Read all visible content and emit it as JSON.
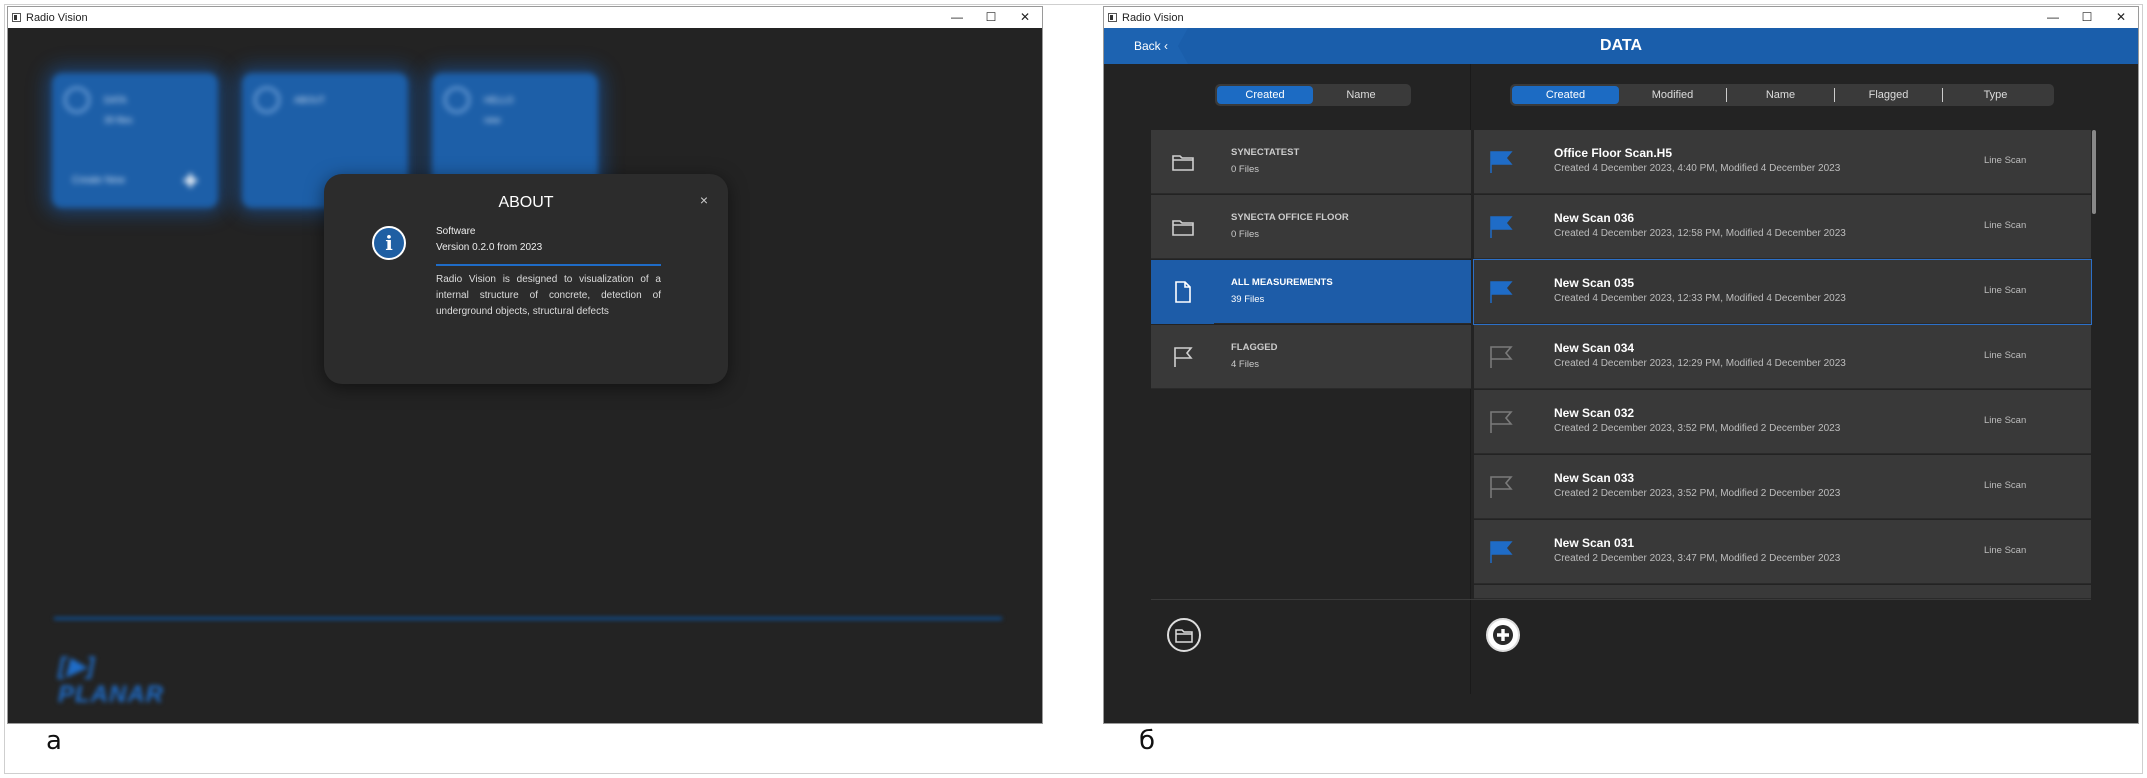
{
  "left_window": {
    "title": "Radio Vision",
    "controls": {
      "minimize": "—",
      "maximize": "☐",
      "close": "✕"
    },
    "tiles": [
      {
        "label": "DATA",
        "sub": "39 files",
        "footer": "Create New",
        "plus": "✚"
      },
      {
        "label": "ABOUT",
        "sub": ""
      },
      {
        "label": "HELLO",
        "sub": "new"
      }
    ],
    "logo": "[▶] PLANAR",
    "about": {
      "title": "ABOUT",
      "close": "×",
      "info_glyph": "i",
      "software_label": "Software",
      "version": "Version 0.2.0 from 2023",
      "description": "Radio Vision is designed to visualization of a internal structure of concrete, detection of underground objects, structural defects"
    }
  },
  "right_window": {
    "title": "Radio Vision",
    "controls": {
      "minimize": "—",
      "maximize": "☐",
      "close": "✕"
    },
    "back_label": "Back  ‹",
    "header_title": "DATA",
    "folder_sort": [
      "Created",
      "Name"
    ],
    "file_sort": [
      "Created",
      "Modified",
      "Name",
      "Flagged",
      "Type"
    ],
    "folders": [
      {
        "name": "SYNECTATEST",
        "count": "0 Files",
        "icon": "folder-icon",
        "selected": false
      },
      {
        "name": "SYNECTA OFFICE FLOOR",
        "count": "0 Files",
        "icon": "folder-icon",
        "selected": false
      },
      {
        "name": "ALL MEASUREMENTS",
        "count": "39 Files",
        "icon": "file-icon",
        "selected": true
      },
      {
        "name": "FLAGGED",
        "count": "4 Files",
        "icon": "flag-outline-icon",
        "selected": false
      }
    ],
    "scans": [
      {
        "name": "Office Floor Scan.H5",
        "date": "Created 4 December 2023, 4:40 PM, Modified 4 December 2023",
        "type": "Line Scan",
        "flagged": true
      },
      {
        "name": "New Scan 036",
        "date": "Created 4 December 2023, 12:58 PM, Modified 4 December 2023",
        "type": "Line Scan",
        "flagged": true
      },
      {
        "name": "New Scan 035",
        "date": "Created 4 December 2023, 12:33 PM, Modified 4 December 2023",
        "type": "Line Scan",
        "flagged": true
      },
      {
        "name": "New Scan 034",
        "date": "Created 4 December 2023, 12:29 PM, Modified 4 December 2023",
        "type": "Line Scan",
        "flagged": false
      },
      {
        "name": "New Scan 032",
        "date": "Created 2 December 2023, 3:52 PM, Modified 2 December 2023",
        "type": "Line Scan",
        "flagged": false
      },
      {
        "name": "New Scan 033",
        "date": "Created 2 December 2023, 3:52 PM, Modified 2 December 2023",
        "type": "Line Scan",
        "flagged": false
      },
      {
        "name": "New Scan 031",
        "date": "Created 2 December 2023, 3:47 PM, Modified 2 December 2023",
        "type": "Line Scan",
        "flagged": true
      }
    ]
  },
  "captions": {
    "left": "а",
    "right": "б"
  },
  "colors": {
    "accent": "#1c6bc3",
    "panel": "#393939",
    "background": "#232323",
    "flag_on": "#1f6cc7",
    "flag_off": "#7a7a7a"
  }
}
